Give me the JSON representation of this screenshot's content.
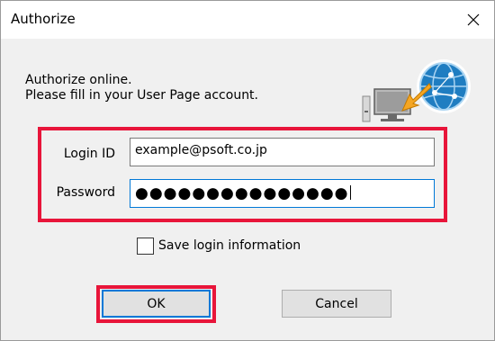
{
  "window": {
    "title": "Authorize"
  },
  "intro": {
    "line1": "Authorize online.",
    "line2": "Please fill in your User Page account."
  },
  "form": {
    "login_id_label": "Login ID",
    "login_id_value": "example@psoft.co.jp",
    "password_label": "Password",
    "password_mask": "●●●●●●●●●●●●●●●"
  },
  "options": {
    "save_login_label": "Save login information",
    "save_login_checked": false
  },
  "buttons": {
    "ok_label": "OK",
    "cancel_label": "Cancel"
  },
  "colors": {
    "highlight": "#e8153a",
    "focus_border": "#0078d7",
    "globe": "#1f7dc1",
    "arrow": "#f5a623"
  },
  "icons": {
    "close": "close-icon",
    "computer": "computer-icon",
    "globe": "globe-network-icon",
    "arrow": "arrow-icon"
  }
}
